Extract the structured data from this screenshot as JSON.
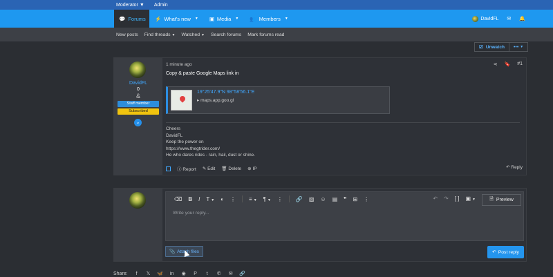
{
  "topbar": {
    "moderator": "Moderator",
    "admin": "Admin"
  },
  "nav": {
    "items": [
      {
        "label": "Forums",
        "icon": "chat-icon"
      },
      {
        "label": "What's new",
        "icon": "bolt-icon"
      },
      {
        "label": "Media",
        "icon": "media-icon"
      },
      {
        "label": "Members",
        "icon": "members-icon"
      }
    ],
    "user": "DavidFL"
  },
  "subnav": [
    "New posts",
    "Find threads",
    "Watched",
    "Search forums",
    "Mark forums read"
  ],
  "thread_actions": {
    "unwatch": "Unwatch",
    "more": "•••"
  },
  "post": {
    "time": "1 minute ago",
    "number": "#1",
    "message": "Copy & paste Google Maps link in",
    "embed": {
      "title": "19°25'47.9\"N 98°58'56.1\"E",
      "domain": "maps.app.goo.gl"
    },
    "signature": [
      "Cheers",
      "DavidFL",
      "Keep the power on",
      "https://www.thegtrider.com/",
      "He who dares rides - rain, hail, dust or shine."
    ],
    "footer": {
      "report": "Report",
      "edit": "Edit",
      "delete": "Delete",
      "ip": "IP",
      "reply": "Reply"
    },
    "user": {
      "name": "DavidFL",
      "points": "0",
      "amp": "&",
      "staff": "Staff member",
      "subscribed": "Subscribed"
    }
  },
  "reply": {
    "placeholder": "Write your reply...",
    "preview": "Preview",
    "attach": "Attach files",
    "post_reply": "Post reply"
  },
  "share": {
    "label": "Share:"
  },
  "colors": {
    "accent": "#1e98f0",
    "topbar": "#2a64b4",
    "link": "#40a8ff",
    "subscribed": "#f1c40f"
  }
}
